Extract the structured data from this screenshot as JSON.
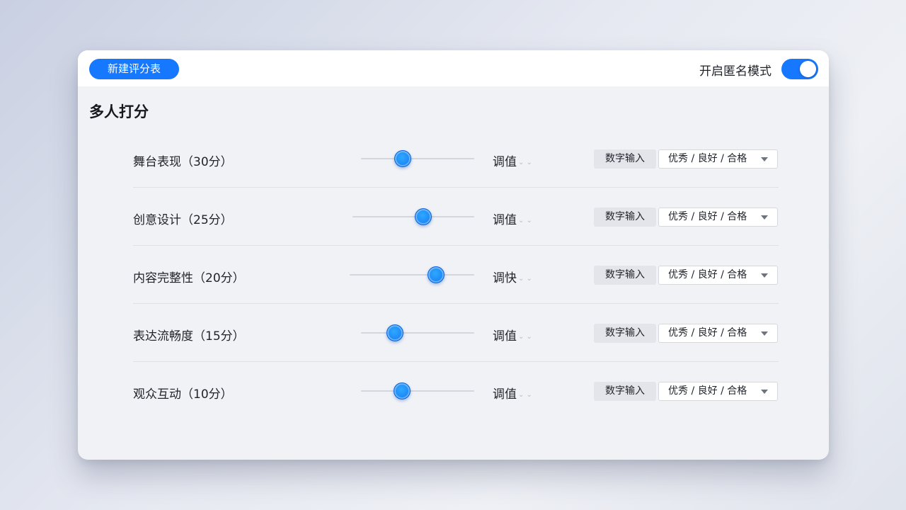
{
  "topbar": {
    "new_button": "新建评分表",
    "anonymous_label": "开启匿名模式",
    "anonymous_on": true
  },
  "section_title": "多人打分",
  "tune_chevrons": "⌄ ⌄",
  "criteria": [
    {
      "label": "舞台表现（30分）",
      "slider_value": 0.37,
      "tune_label": "调值",
      "num_input_label": "数字输入",
      "grade_options": "优秀 / 良好 / 合格"
    },
    {
      "label": "创意设计（25分）",
      "slider_value": 0.55,
      "tune_label": "调值",
      "num_input_label": "数字输入",
      "grade_options": "优秀 / 良好 / 合格"
    },
    {
      "label": "内容完整性（20分）",
      "slider_value": 0.66,
      "tune_label": "调快",
      "num_input_label": "数字输入",
      "grade_options": "优秀 / 良好 / 合格"
    },
    {
      "label": "表达流畅度（15分）",
      "slider_value": 0.3,
      "tune_label": "调值",
      "num_input_label": "数字输入",
      "grade_options": "优秀 / 良好 / 合格"
    },
    {
      "label": "观众互动（10分）",
      "slider_value": 0.36,
      "tune_label": "调值",
      "num_input_label": "数字输入",
      "grade_options": "优秀 / 良好 / 合格"
    }
  ],
  "colors": {
    "accent": "#1677ff",
    "panel_bg": "#f1f2f6",
    "topbar_bg": "#ffffff"
  }
}
